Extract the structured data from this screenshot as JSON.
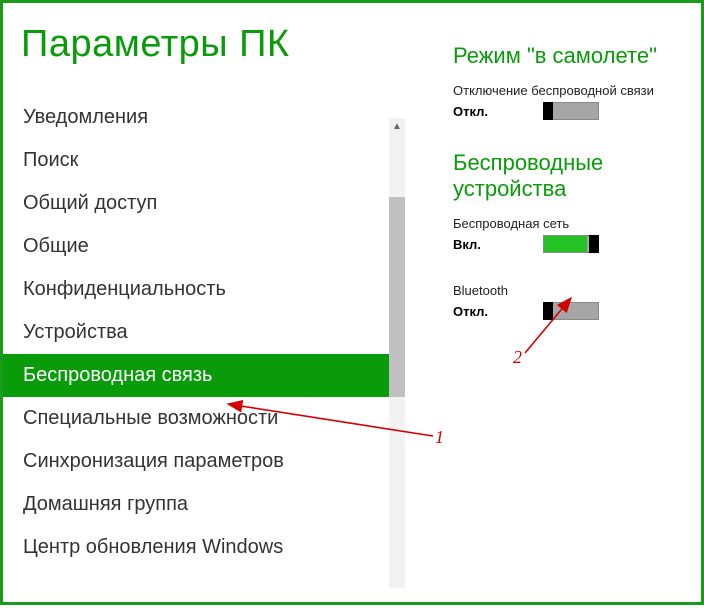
{
  "page_title": "Параметры ПК",
  "sidebar": {
    "items": [
      {
        "label": "Уведомления",
        "selected": false
      },
      {
        "label": "Поиск",
        "selected": false
      },
      {
        "label": "Общий доступ",
        "selected": false
      },
      {
        "label": "Общие",
        "selected": false
      },
      {
        "label": "Конфиденциальность",
        "selected": false
      },
      {
        "label": "Устройства",
        "selected": false
      },
      {
        "label": "Беспроводная связь",
        "selected": true
      },
      {
        "label": "Специальные возможности",
        "selected": false
      },
      {
        "label": "Синхронизация параметров",
        "selected": false
      },
      {
        "label": "Домашняя группа",
        "selected": false
      },
      {
        "label": "Центр обновления Windows",
        "selected": false
      }
    ]
  },
  "content": {
    "airplane": {
      "heading": "Режим \"в самолете\"",
      "label": "Отключение беспроводной связи",
      "value": "Откл.",
      "state": "off"
    },
    "wireless": {
      "heading": "Беспроводные устройства",
      "wifi": {
        "label": "Беспроводная сеть",
        "value": "Вкл.",
        "state": "on"
      },
      "bluetooth": {
        "label": "Bluetooth",
        "value": "Откл.",
        "state": "off"
      }
    }
  },
  "annotations": {
    "one": "1",
    "two": "2"
  },
  "colors": {
    "accent": "#0a9b0a",
    "border": "#1a9b1a",
    "annotation": "#d40000"
  }
}
